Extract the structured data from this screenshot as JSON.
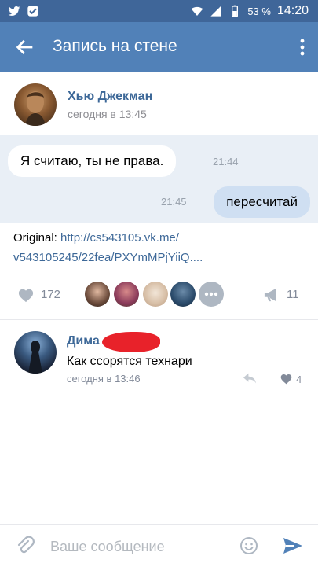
{
  "status_bar": {
    "battery": "53 %",
    "time": "14:20"
  },
  "appbar": {
    "title": "Запись на стене"
  },
  "post": {
    "author_name": "Хью Джекман",
    "time": "сегодня в 13:45",
    "messages": [
      {
        "text": "Я считаю, ты не права.",
        "time": "21:44"
      },
      {
        "text": "пересчитай",
        "time": "21:45"
      }
    ],
    "original_prefix": "Original:",
    "original_link_line1": "http://cs543105.vk.me/",
    "original_link_line2": "v543105245/22fea/PXYmMPjYiiQ....",
    "likes": "172",
    "shares": "11"
  },
  "comment": {
    "author_name": "Дима",
    "text": "Как ссорятся технари",
    "time": "сегодня в 13:46",
    "likes": "4"
  },
  "composer": {
    "placeholder": "Ваше сообщение"
  }
}
